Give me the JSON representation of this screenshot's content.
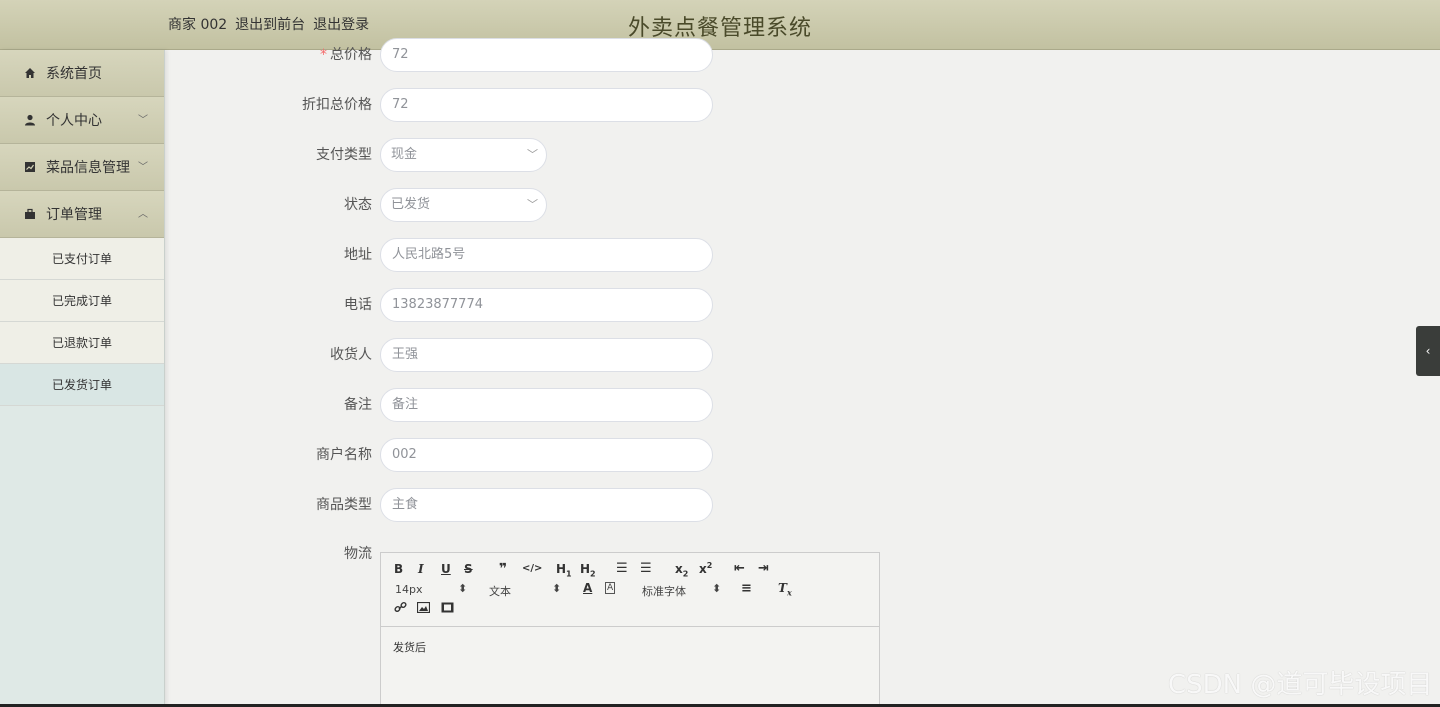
{
  "header": {
    "user_label": "商家 002",
    "back_front_link": "退出到前台",
    "logout_link": "退出登录",
    "title": "外卖点餐管理系统"
  },
  "sidebar": {
    "items": [
      {
        "label": "系统首页",
        "icon": "home-icon"
      },
      {
        "label": "个人中心",
        "icon": "user-icon"
      },
      {
        "label": "菜品信息管理",
        "icon": "chart-icon"
      },
      {
        "label": "订单管理",
        "icon": "briefcase-icon"
      }
    ],
    "sub_items": [
      {
        "label": "已支付订单"
      },
      {
        "label": "已完成订单"
      },
      {
        "label": "已退款订单"
      },
      {
        "label": "已发货订单"
      }
    ]
  },
  "form": {
    "total_price": {
      "label": "总价格",
      "value": "72"
    },
    "discount_total": {
      "label": "折扣总价格",
      "value": "72"
    },
    "pay_type": {
      "label": "支付类型",
      "value": "现金"
    },
    "status": {
      "label": "状态",
      "value": "已发货"
    },
    "address": {
      "label": "地址",
      "value": "人民北路5号"
    },
    "phone": {
      "label": "电话",
      "value": "13823877774"
    },
    "receiver": {
      "label": "收货人",
      "value": "王强"
    },
    "remark": {
      "label": "备注",
      "placeholder": "备注"
    },
    "merchant_name": {
      "label": "商户名称",
      "value": "002"
    },
    "goods_type": {
      "label": "商品类型",
      "value": "主食"
    },
    "logistics": {
      "label": "物流"
    }
  },
  "editor": {
    "font_size": "14px",
    "block_type": "文本",
    "font_family": "标准字体",
    "content": "发货后"
  },
  "watermark": "CSDN @道可毕设项目"
}
